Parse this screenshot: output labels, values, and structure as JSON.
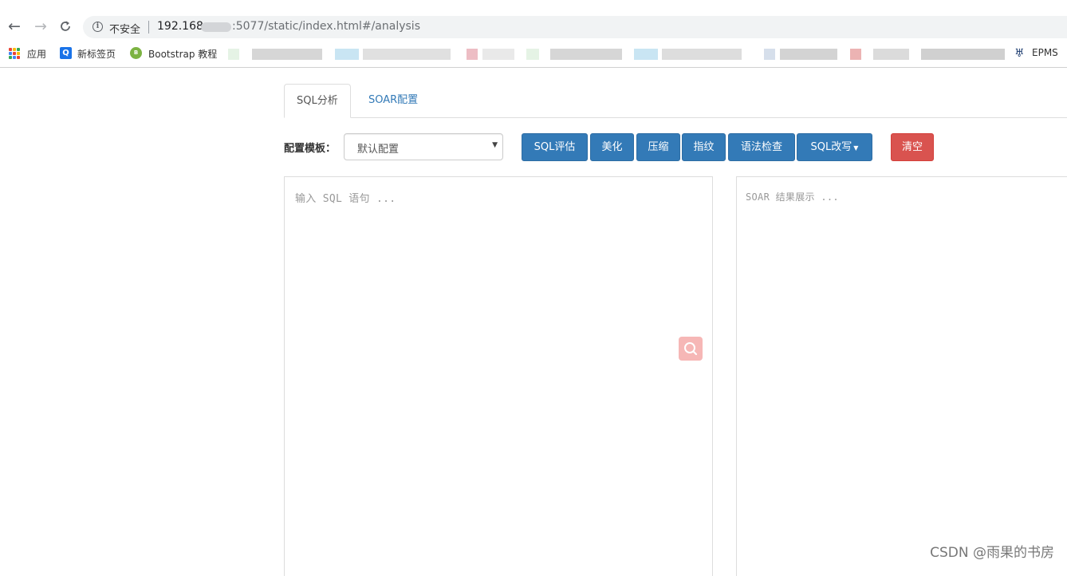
{
  "browser": {
    "nav": {
      "back": "←",
      "forward": "→",
      "reload": "C"
    },
    "omnibox": {
      "security_label": "不安全",
      "url_host": "192.168.",
      "url_rest": ":5077/static/index.html#/analysis"
    },
    "bookmarks": [
      {
        "icon": "apps-icon",
        "label": "应用"
      },
      {
        "icon": "new-tab-icon",
        "label": "新标签页"
      },
      {
        "icon": "bootstrap-icon",
        "label": "Bootstrap 教程"
      },
      {
        "icon": "epms-icon",
        "label": "EPMS"
      }
    ]
  },
  "tabs": [
    {
      "label": "SQL分析",
      "active": true
    },
    {
      "label": "SOAR配置",
      "active": false
    }
  ],
  "toolbar": {
    "config_label": "配置模板：",
    "config_select_value": "默认配置",
    "buttons": {
      "evaluate": "SQL评估",
      "beautify": "美化",
      "compress": "压缩",
      "fingerprint": "指纹",
      "syntax_check": "语法检查",
      "rewrite": "SQL改写",
      "clear": "清空"
    }
  },
  "editor": {
    "sql_placeholder": "输入 SQL 语句 ...",
    "result_placeholder": "SOAR 结果展示 ..."
  },
  "watermark": "CSDN @雨果的书房",
  "colors": {
    "primary": "#337ab7",
    "danger": "#d9534f",
    "link": "#337ab7",
    "search_fab": "#f6b7b6"
  }
}
